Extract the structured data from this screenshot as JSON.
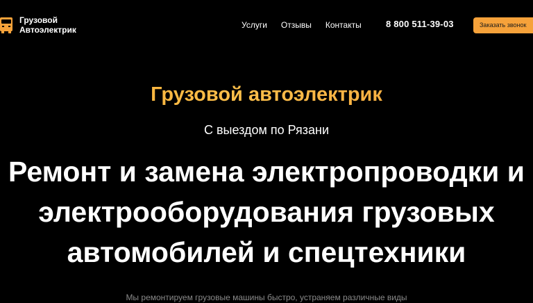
{
  "colors": {
    "background": "#000000",
    "accent": "#f6a23a",
    "text": "#ffffff",
    "muted": "#8a8a8a"
  },
  "header": {
    "logo": {
      "icon": "truck-icon",
      "line1": "Грузовой",
      "line2": "Автоэлектрик"
    },
    "nav": [
      {
        "label": "Услуги"
      },
      {
        "label": "Отзывы"
      },
      {
        "label": "Контакты"
      }
    ],
    "phone": "8 800 511-39-03",
    "cta_label": "Заказать звонок"
  },
  "hero": {
    "kicker": "Грузовой автоэлектрик",
    "subtitle": "С выездом по Рязани",
    "title_lines": [
      "Ремонт и замена электропроводки и",
      "электрооборудования грузовых",
      "автомобилей и спецтехники"
    ],
    "description": "Мы ремонтируем грузовые машины быстро, устраняем различные виды"
  }
}
